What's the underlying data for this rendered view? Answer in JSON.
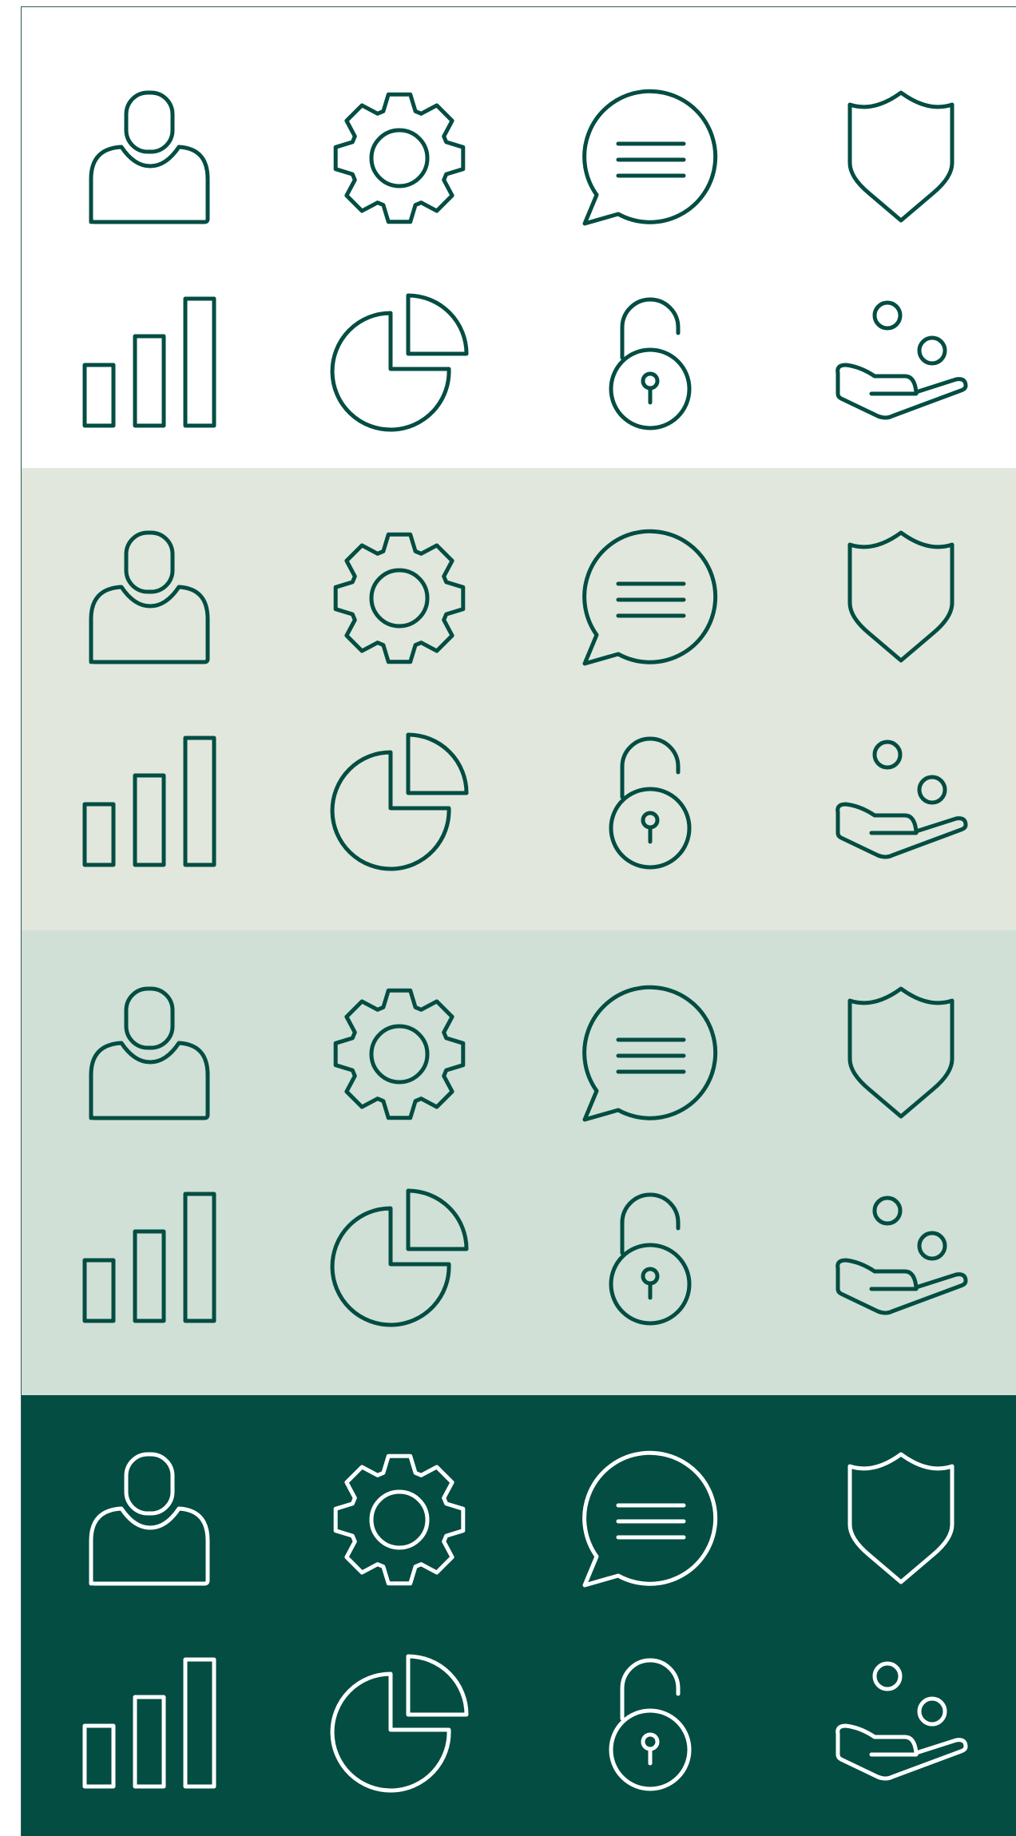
{
  "colors": {
    "frame_border": "#2e5a50"
  },
  "icon_names": [
    "user-icon",
    "gear-icon",
    "chat-bubble-icon",
    "shield-icon",
    "bar-chart-icon",
    "pie-chart-icon",
    "unlocked-padlock-icon",
    "hand-coins-icon"
  ],
  "bands": [
    {
      "name": "white",
      "background": "#ffffff",
      "stroke": "#034d43"
    },
    {
      "name": "light-sage",
      "background": "#e1e7dc",
      "stroke": "#034d43"
    },
    {
      "name": "light-mint",
      "background": "#d0e0d6",
      "stroke": "#034d43"
    },
    {
      "name": "dark-green",
      "background": "#034d43",
      "stroke": "#ffffff"
    }
  ]
}
